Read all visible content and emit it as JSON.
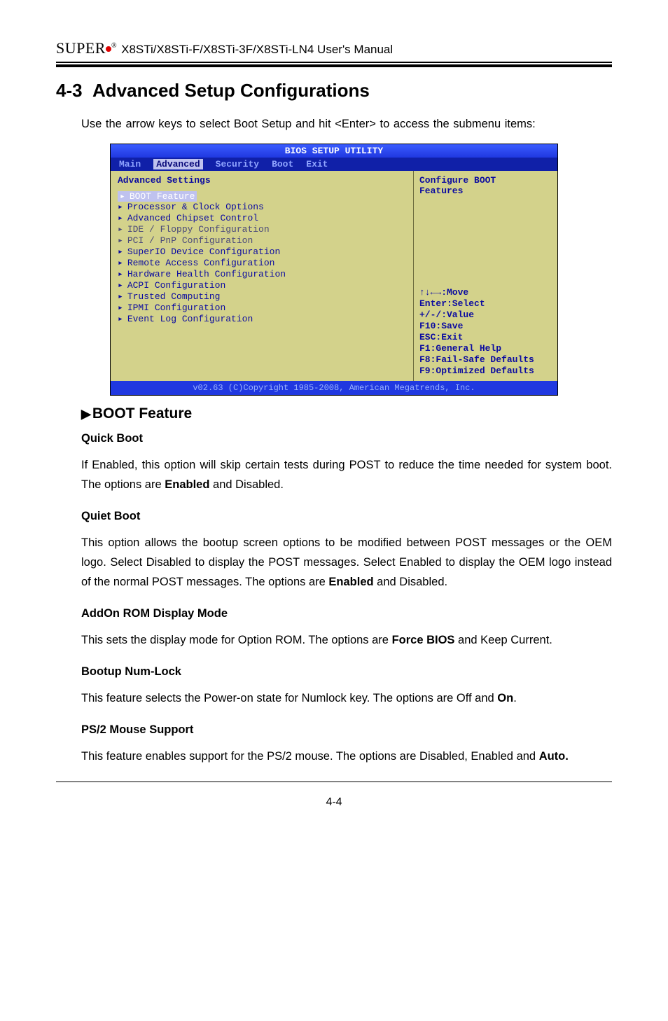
{
  "header": {
    "brand_prefix": "S",
    "brand_rest": "UPER",
    "manual": "X8STi/X8STi-F/X8STi-3F/X8STi-LN4  User's Manual"
  },
  "section": {
    "number": "4-3",
    "title": "Advanced Setup Configurations",
    "intro": "Use the arrow keys to select Boot Setup and hit <Enter> to access the submenu items:"
  },
  "bios": {
    "title": "BIOS SETUP UTILITY",
    "tabs": [
      "Main",
      "Advanced",
      "Security",
      "Boot",
      "Exit"
    ],
    "active_tab_index": 1,
    "panel_heading": "Advanced Settings",
    "menu": [
      {
        "label": "BOOT Feature",
        "selected": true
      },
      {
        "label": "Processor & Clock Options"
      },
      {
        "label": "Advanced Chipset Control"
      },
      {
        "label": "IDE / Floppy Configuration",
        "dim": true
      },
      {
        "label": "PCI / PnP Configuration",
        "dim": true
      },
      {
        "label": "SuperIO Device Configuration"
      },
      {
        "label": "Remote Access Configuration"
      },
      {
        "label": "Hardware Health Configuration"
      },
      {
        "label": "ACPI Configuration"
      },
      {
        "label": "Trusted Computing"
      },
      {
        "label": "IPMI Configuration"
      },
      {
        "label": "Event Log Configuration"
      }
    ],
    "help_top1": "Configure BOOT",
    "help_top2": "Features",
    "keys": [
      "↑↓←→:Move",
      "Enter:Select",
      "+/-/:Value",
      "F10:Save",
      "ESC:Exit",
      "F1:General Help",
      "F8:Fail-Safe Defaults",
      "F9:Optimized Defaults"
    ],
    "footer": "v02.63 (C)Copyright 1985-2008, American Megatrends, Inc."
  },
  "subsection": {
    "heading": "BOOT Feature"
  },
  "items": {
    "quick_boot": {
      "h": "Quick Boot",
      "p": "If Enabled, this option will skip certain tests during POST  to reduce the time needed for system boot. The options are Enabled and Disabled."
    },
    "quiet_boot": {
      "h": "Quiet Boot",
      "p": "This option allows the bootup screen options to be modified between POST messages or the OEM logo. Select Disabled to display the POST messages. Select Enabled to display the OEM logo instead of the normal POST messages. The options are Enabled and Disabled."
    },
    "addon_rom": {
      "h": "AddOn ROM Display Mode",
      "p": "This sets the display mode for Option ROM.  The options are Force BIOS and Keep Current."
    },
    "numlock": {
      "h": "Bootup Num-Lock",
      "p": "This feature selects the Power-on state for Numlock key.  The options are Off and On."
    },
    "ps2": {
      "h": "PS/2 Mouse Support",
      "p": "This feature enables support for the PS/2 mouse.  The options are Disabled, Enabled and Auto."
    }
  },
  "page_number": "4-4"
}
